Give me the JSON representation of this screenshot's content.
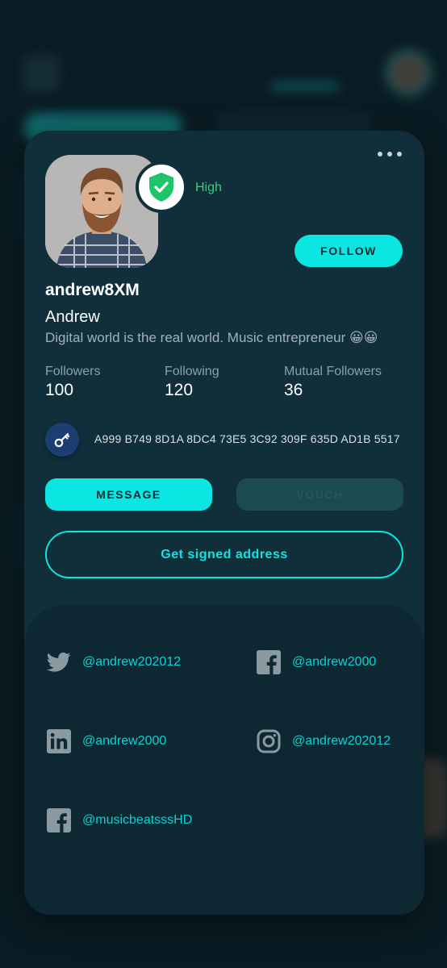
{
  "colors": {
    "accent": "#0be6e2",
    "card_bg": "#102f3a",
    "page_bg": "#0a1c23",
    "trust_green": "#2ed37b",
    "vouch_disabled": "#1b4a4f"
  },
  "profile": {
    "trust_level": "High",
    "follow_label": "FOLLOW",
    "username": "andrew8XM",
    "display_name": "Andrew",
    "bio": "Digital world is the real world.  Music entrepreneur 😀😀",
    "stats": [
      {
        "label": "Followers",
        "value": "100"
      },
      {
        "label": "Following",
        "value": "120"
      },
      {
        "label": "Mutual Followers",
        "value": "36"
      }
    ],
    "public_key": "A999 B749 8D1A 8DC4 73E5 3C92 309F 635D AD1B 5517",
    "message_label": "MESSAGE",
    "vouch_label": "VOUCH",
    "signed_address_label": "Get signed address"
  },
  "socials": [
    {
      "icon": "twitter-icon",
      "handle": "@andrew202012"
    },
    {
      "icon": "facebook-icon",
      "handle": "@andrew2000"
    },
    {
      "icon": "linkedin-icon",
      "handle": "@andrew2000"
    },
    {
      "icon": "instagram-icon",
      "handle": "@andrew202012"
    },
    {
      "icon": "facebook-icon",
      "handle": "@musicbeatsssHD"
    }
  ]
}
